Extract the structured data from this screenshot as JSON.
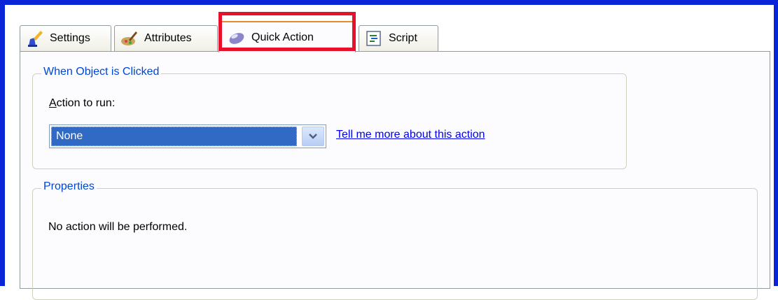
{
  "tabs": [
    {
      "label": "Settings",
      "icon": "settings-icon",
      "active": false
    },
    {
      "label": "Attributes",
      "icon": "attributes-icon",
      "active": false
    },
    {
      "label": "Quick Action",
      "icon": "quick-action-icon",
      "active": true
    },
    {
      "label": "Script",
      "icon": "script-icon",
      "active": false
    }
  ],
  "click_group": {
    "legend": "When Object is Clicked",
    "action_label_underlined": "A",
    "action_label_rest": "ction to run:",
    "action_select_value": "None",
    "more_link": "Tell me more about this action"
  },
  "properties_group": {
    "legend": "Properties",
    "description": "No action will be performed."
  },
  "colors": {
    "window_frame": "#0a24d8",
    "highlight_box": "#e8102a",
    "group_legend": "#0046d5",
    "selection": "#316ac5"
  }
}
